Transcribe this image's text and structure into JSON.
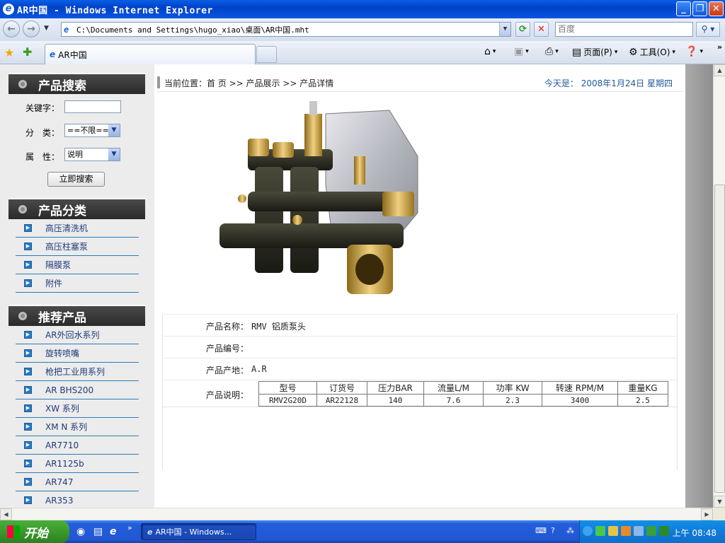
{
  "window": {
    "title": "AR中国 - Windows Internet Explorer",
    "buttons": {
      "minimize": "_",
      "maximize": "❐",
      "close": "✕"
    }
  },
  "addressbar": {
    "url": "C:\\Documents and Settings\\hugo_xiao\\桌面\\AR中国.mht",
    "search_placeholder": "百度"
  },
  "tabs": [
    {
      "label": "AR中国"
    }
  ],
  "commands": {
    "page": "页面(P)",
    "tools": "工具(O)"
  },
  "sidebar": {
    "search": {
      "heading": "产品搜索",
      "keyword_label": "关键字：",
      "category_label": "分　类：",
      "category_value": "==不限==",
      "attribute_label": "属　性：",
      "attribute_value": "说明",
      "submit": "立即搜索"
    },
    "categories": {
      "heading": "产品分类",
      "items": [
        "高压清洗机",
        "高压柱塞泵",
        "隔膜泵",
        "附件"
      ]
    },
    "recommended": {
      "heading": "推荐产品",
      "items": [
        "AR外回水系列",
        "旋转喷嘴",
        "枪把工业用系列",
        "AR BHS200",
        "XW 系列",
        "XM N 系列",
        "AR7710",
        "AR1125b",
        "AR747",
        "AR353"
      ]
    }
  },
  "breadcrumb": {
    "text": "当前位置：首 页 >> 产品展示 >> 产品详情",
    "date": "今天是： 2008年1月24日 星期四"
  },
  "product": {
    "name_label": "产品名称：",
    "name": "RMV 铝质泵头",
    "code_label": "产品编号：",
    "code": "",
    "origin_label": "产品产地：",
    "origin": "A.R",
    "desc_label": "产品说明：",
    "spec_headers": [
      "型号",
      "订货号",
      "压力BAR",
      "流量L/M",
      "功率 KW",
      "转速 RPM/M",
      "重量KG"
    ],
    "spec_row": [
      "RMV2G20D",
      "AR22128",
      "140",
      "7.6",
      "2.3",
      "3400",
      "2.5"
    ]
  },
  "taskbar": {
    "start": "开始",
    "task": "AR中国 - Windows...",
    "clock": "上午 08:48"
  },
  "colors": {
    "link": "#1E3A7A",
    "date": "#1E5A9A",
    "sidebar_heading": "#2A2A2A",
    "titlebar": "#0041C8"
  }
}
